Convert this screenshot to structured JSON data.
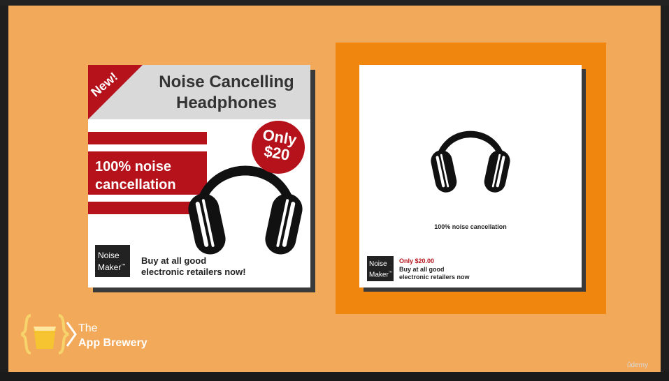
{
  "colors": {
    "background": "#f2a95a",
    "accent_red": "#b5121b",
    "frame_orange": "#f0860e",
    "header_grey": "#d9d9d9",
    "dark": "#222222"
  },
  "ad_busy": {
    "badge": "New!",
    "title_line1": "Noise Cancelling",
    "title_line2": "Headphones",
    "price_line1": "Only",
    "price_line2": "$20",
    "feature_line1": "100% noise",
    "feature_line2": "cancellation",
    "logo_line1": "Noise",
    "logo_line2": "Maker",
    "logo_tm": "™",
    "cta_line1": "Buy at all good",
    "cta_line2": "electronic retailers now!",
    "icon": "headphones-icon"
  },
  "ad_clean": {
    "feature": "100% noise cancellation",
    "logo_line1": "Noise",
    "logo_line2": "Maker",
    "logo_tm": "™",
    "price": "Only $20.00",
    "cta_line1": "Buy at all good",
    "cta_line2": "electronic retailers now",
    "icon": "headphones-icon"
  },
  "brand": {
    "line1": "The",
    "line2": "App Brewery",
    "icon": "braces-cup-icon"
  },
  "watermark": "ûdemy"
}
